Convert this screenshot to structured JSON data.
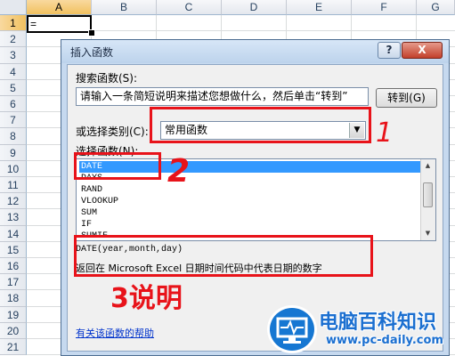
{
  "sheet": {
    "columns": [
      "A",
      "B",
      "C",
      "D",
      "E",
      "F",
      "G"
    ],
    "rows": [
      "1",
      "2",
      "3",
      "4",
      "5",
      "6",
      "7",
      "8",
      "9",
      "10",
      "11",
      "12",
      "13",
      "14",
      "15",
      "16",
      "17",
      "18",
      "19",
      "20",
      "21"
    ],
    "active_cell_value": "="
  },
  "dialog": {
    "title": "插入函数",
    "help_button": "?",
    "close_button": "X",
    "search_label": "搜索函数(S):",
    "search_value": "请输入一条简短说明来描述您想做什么，然后单击“转到”",
    "goto_button": "转到(G)",
    "category_label": "或选择类别(C):",
    "category_value": "常用函数",
    "function_list_label": "选择函数(N):",
    "functions": [
      "DATE",
      "DAYS",
      "RAND",
      "VLOOKUP",
      "SUM",
      "IF",
      "SUMIF"
    ],
    "selected_function": "DATE",
    "syntax": "DATE(year,month,day)",
    "description": "返回在 Microsoft Excel 日期时间代码中代表日期的数字",
    "help_link": "有关该函数的帮助"
  },
  "annotations": {
    "label_1": "1",
    "label_2": "2",
    "label_3": "3说明",
    "color": "#e8131a"
  },
  "watermark": {
    "title": "电脑百科知识",
    "url": "www.pc-daily.com"
  }
}
